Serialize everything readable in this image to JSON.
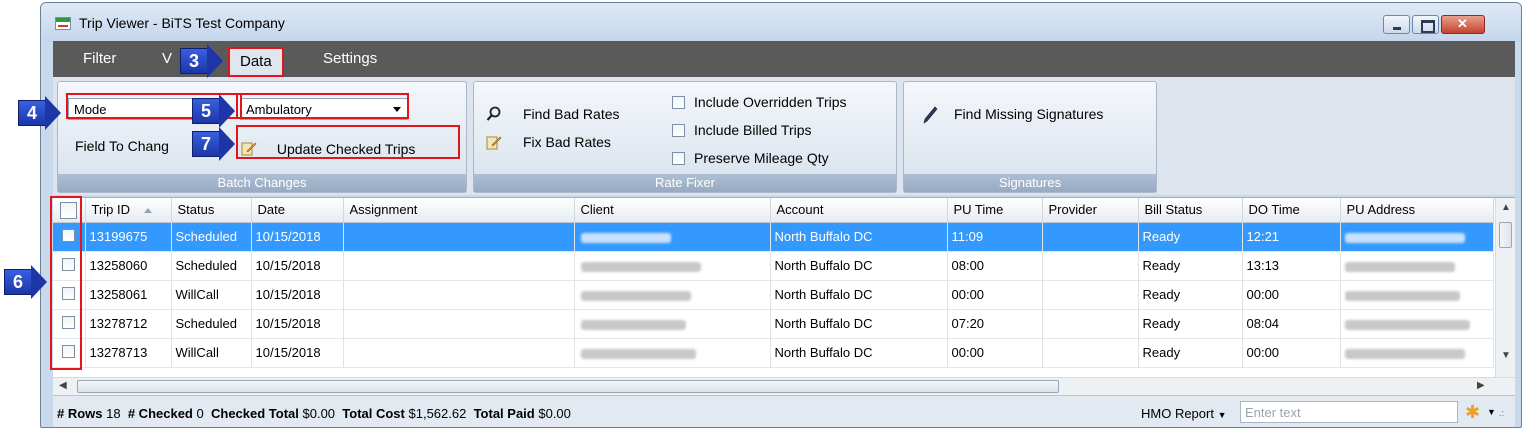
{
  "window": {
    "title": "Trip Viewer - BiTS Test Company"
  },
  "menu": [
    {
      "label": "Filter"
    },
    {
      "label": "V"
    },
    {
      "label": "Data",
      "active": true
    },
    {
      "label": "Settings"
    }
  ],
  "ribbon": {
    "batch": {
      "label": "Batch Changes",
      "field_value": "Mode",
      "mode_value": "Ambulatory",
      "field_to_change_label": "Field To Chang",
      "update_label": "Update Checked Trips"
    },
    "rate_fixer": {
      "label": "Rate Fixer",
      "find_bad_rates": "Find Bad Rates",
      "fix_bad_rates": "Fix Bad Rates",
      "include_overridden": "Include Overridden Trips",
      "include_billed": "Include Billed Trips",
      "preserve_mileage": "Preserve Mileage Qty"
    },
    "signatures": {
      "label": "Signatures",
      "find_missing": "Find Missing Signatures"
    }
  },
  "grid": {
    "columns": [
      "Trip ID",
      "Status",
      "Date",
      "Assignment",
      "Client",
      "Account",
      "PU Time",
      "Provider",
      "Bill Status",
      "DO Time",
      "PU Address"
    ],
    "rows": [
      {
        "trip_id": "13199675",
        "status": "Scheduled",
        "date": "10/15/2018",
        "account": "North Buffalo DC",
        "pu_time": "11:09",
        "bill_status": "Ready",
        "do_time": "12:21",
        "selected": true
      },
      {
        "trip_id": "13258060",
        "status": "Scheduled",
        "date": "10/15/2018",
        "account": "North Buffalo DC",
        "pu_time": "08:00",
        "bill_status": "Ready",
        "do_time": "13:13"
      },
      {
        "trip_id": "13258061",
        "status": "WillCall",
        "date": "10/15/2018",
        "account": "North Buffalo DC",
        "pu_time": "00:00",
        "bill_status": "Ready",
        "do_time": "00:00"
      },
      {
        "trip_id": "13278712",
        "status": "Scheduled",
        "date": "10/15/2018",
        "account": "North Buffalo DC",
        "pu_time": "07:20",
        "bill_status": "Ready",
        "do_time": "08:04"
      },
      {
        "trip_id": "13278713",
        "status": "WillCall",
        "date": "10/15/2018",
        "account": "North Buffalo DC",
        "pu_time": "00:00",
        "bill_status": "Ready",
        "do_time": "00:00"
      }
    ]
  },
  "status_bar": {
    "rows_label": "# Rows",
    "rows_value": "18",
    "checked_label": "# Checked",
    "checked_value": "0",
    "checked_total_label": "Checked Total",
    "checked_total_value": "$0.00",
    "total_cost_label": "Total Cost",
    "total_cost_value": "$1,562.62",
    "total_paid_label": "Total Paid",
    "total_paid_value": "$0.00",
    "report_label": "HMO Report",
    "search_placeholder": "Enter text"
  },
  "callouts": [
    "3",
    "4",
    "5",
    "6",
    "7"
  ],
  "colors": {
    "accent_red": "#e0161c",
    "callout_blue": "#1c36a8",
    "selection": "#3399ff"
  }
}
